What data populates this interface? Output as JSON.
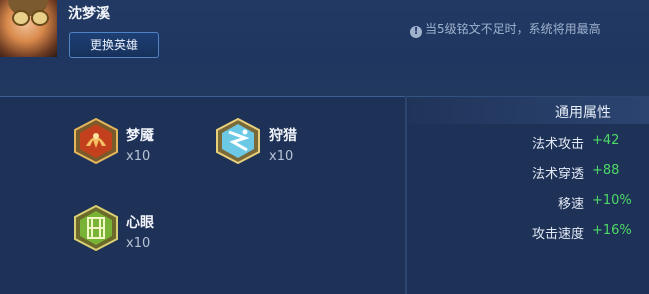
{
  "hero": {
    "name": "沈梦溪",
    "change_button": "更换英雄"
  },
  "notice": {
    "icon": "info-icon",
    "text": "当5级铭文不足时，系统将用最高"
  },
  "inscriptions": [
    {
      "name": "梦魇",
      "count": "x10",
      "icon": "nightmare-emblem-icon",
      "color": "#d0562a"
    },
    {
      "name": "狩猎",
      "count": "x10",
      "icon": "hunt-emblem-icon",
      "color": "#3fa7c9"
    },
    {
      "name": "心眼",
      "count": "x10",
      "icon": "mind-eye-emblem-icon",
      "color": "#7fb33a"
    }
  ],
  "attributes": {
    "title": "通用属性",
    "items": [
      {
        "label": "法术攻击",
        "value": "+42"
      },
      {
        "label": "法术穿透",
        "value": "+88"
      },
      {
        "label": "移速",
        "value": "+10%"
      },
      {
        "label": "攻击速度",
        "value": "+16%"
      }
    ]
  },
  "colors": {
    "bg": "#1e3156",
    "accent_green": "#4cd967",
    "button_border": "#4f83c4"
  }
}
